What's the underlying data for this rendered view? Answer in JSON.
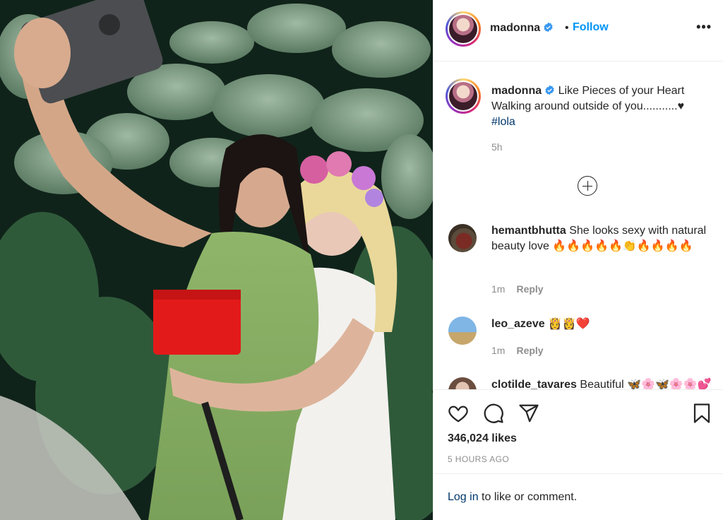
{
  "post": {
    "username": "madonna",
    "dot": "•",
    "follow_label": "Follow",
    "more_label": "•••",
    "caption": {
      "username": "madonna",
      "text": "Like Pieces of your Heart Walking around outside of you...........♥",
      "hashtag": "#lola",
      "time": "5h"
    },
    "comments": [
      {
        "username": "hemantbhutta",
        "text": "She looks sexy with natural beauty love 🔥🔥🔥🔥🔥👏🔥🔥🔥🔥",
        "time": "1m",
        "reply_label": "Reply"
      },
      {
        "username": "leo_azeve",
        "text": "👸👸❤️",
        "time": "1m",
        "reply_label": "Reply"
      },
      {
        "username": "clotilde_tavares",
        "text": "Beautiful 🦋🌸🦋🌸🌸💕"
      }
    ],
    "likes": "346,024 likes",
    "time_ago": "5 HOURS AGO",
    "login": {
      "link": "Log in",
      "rest": " to like or comment."
    }
  },
  "colors": {
    "follow": "#0095f6",
    "hashtag": "#00376b",
    "muted": "#8e8e8e",
    "text": "#262626"
  },
  "icons": [
    "verified-badge-icon",
    "add-comment-icon",
    "heart-icon",
    "comment-icon",
    "share-icon",
    "save-icon",
    "more-icon"
  ]
}
